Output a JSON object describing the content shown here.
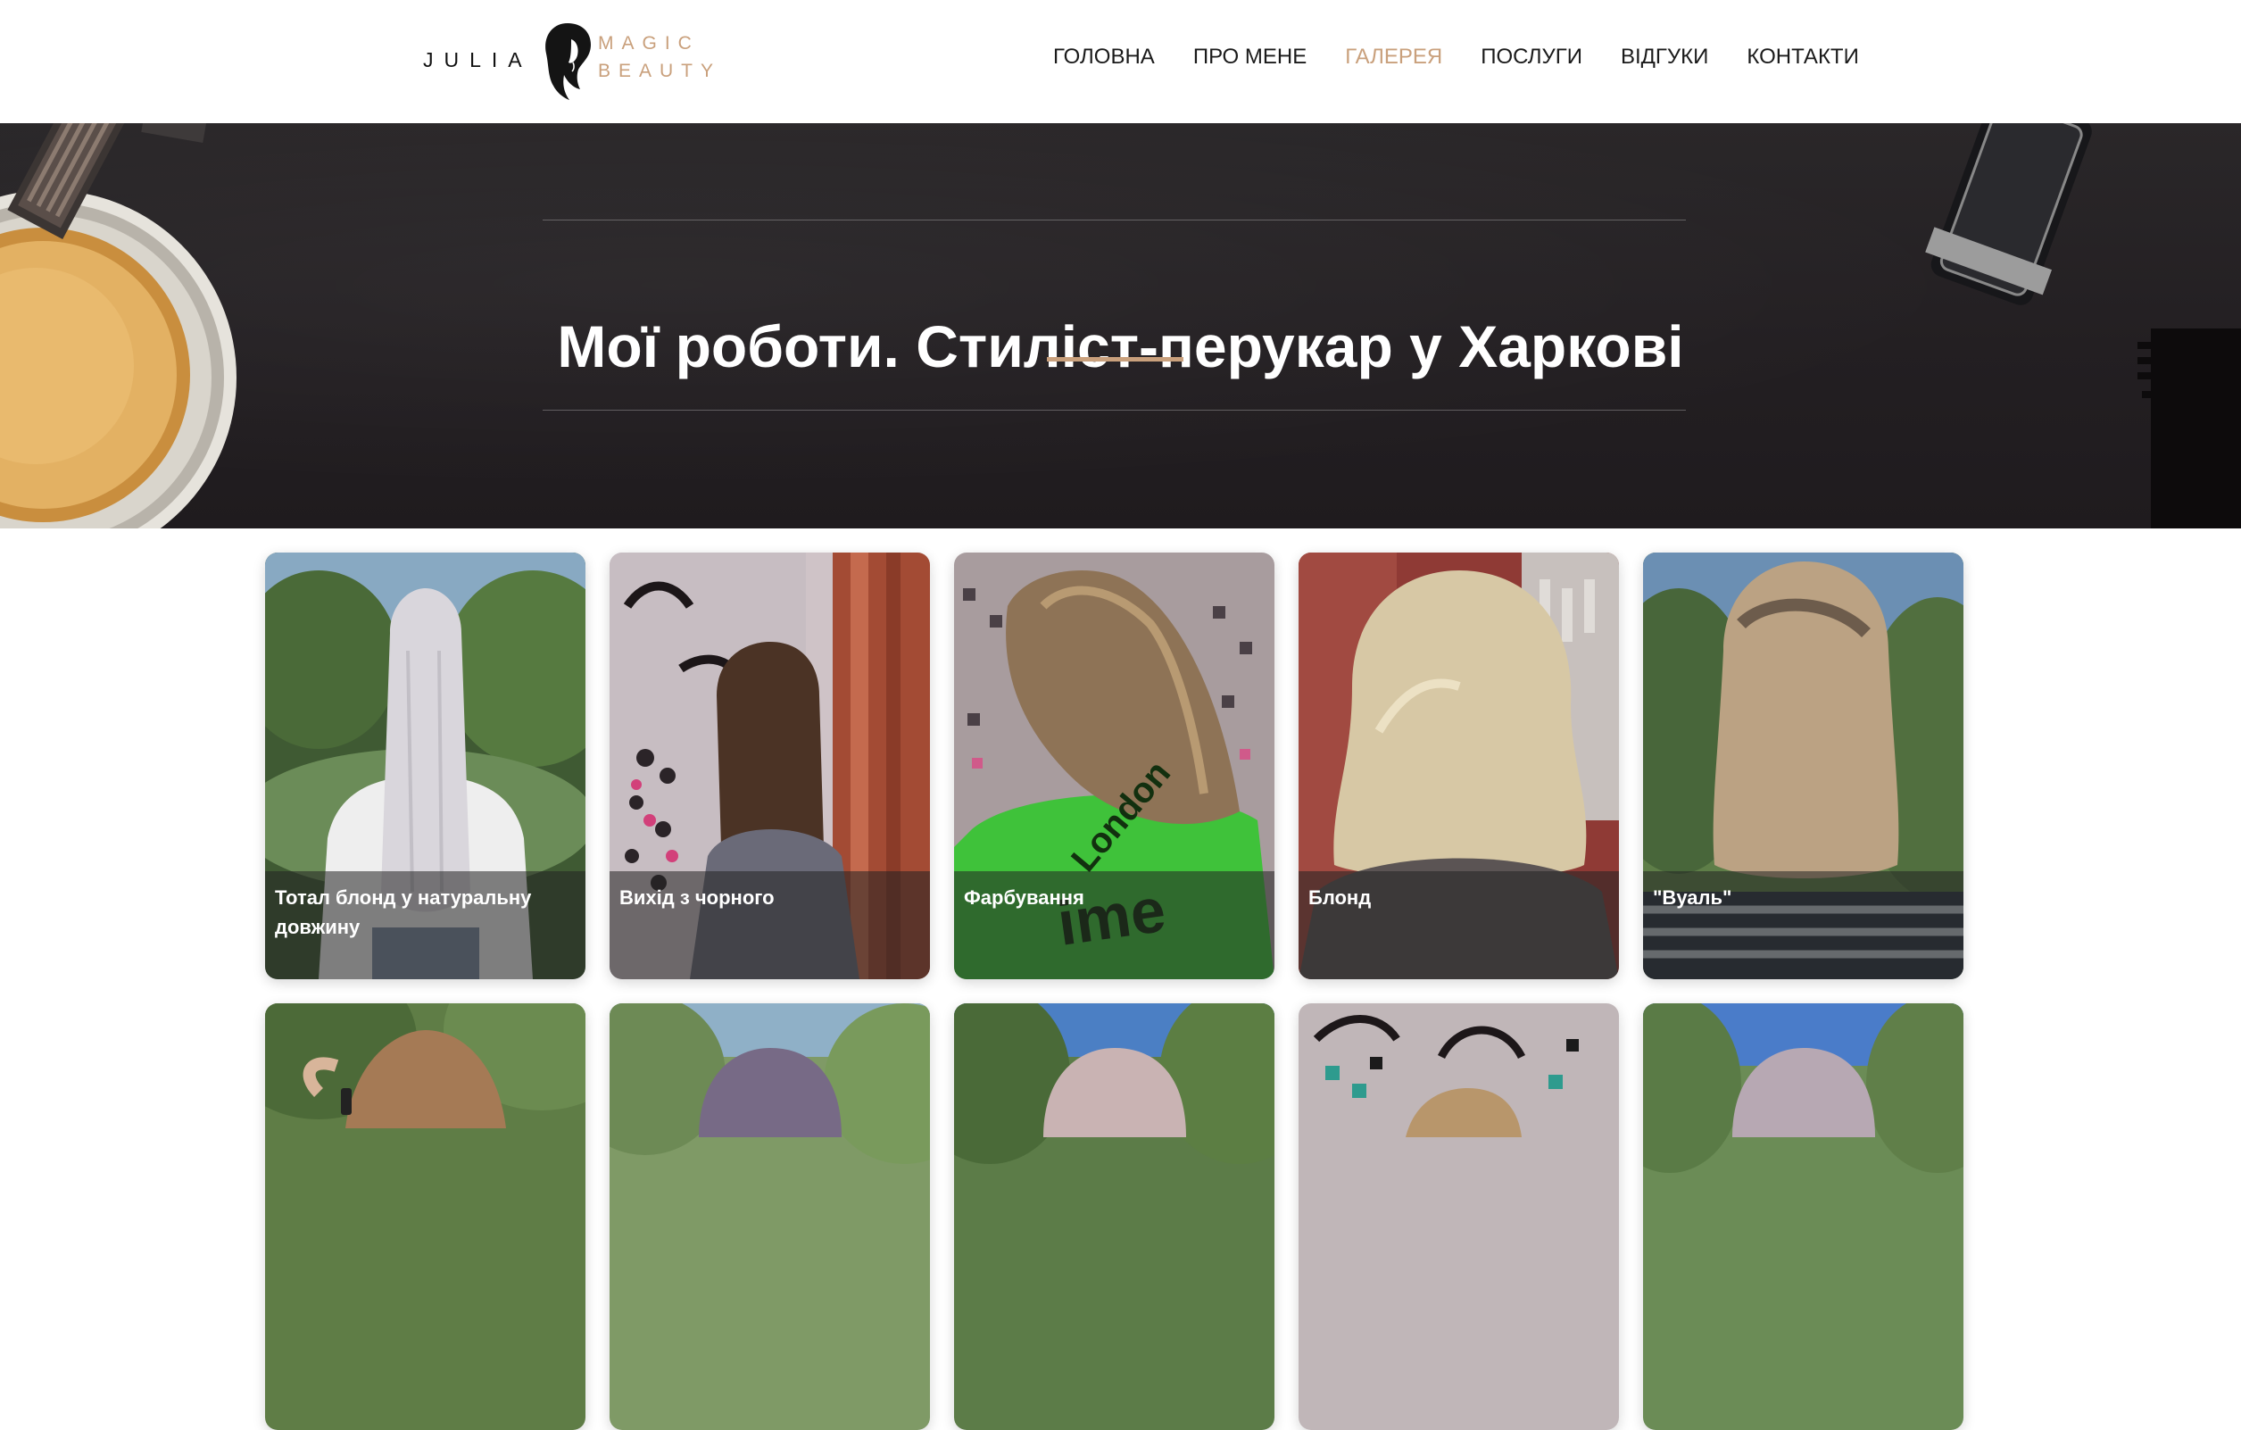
{
  "logo": {
    "left_text": "JULIA",
    "right_top": "MAGIC",
    "right_bottom": "BEAUTY"
  },
  "nav": {
    "items": [
      {
        "label": "ГОЛОВНА",
        "active": false
      },
      {
        "label": "ПРО МЕНЕ",
        "active": false
      },
      {
        "label": "ГАЛЕРЕЯ",
        "active": true
      },
      {
        "label": "ПОСЛУГИ",
        "active": false
      },
      {
        "label": "ВІДГУКИ",
        "active": false
      },
      {
        "label": "КОНТАКТИ",
        "active": false
      }
    ]
  },
  "hero": {
    "title": "Мої роботи. Стиліст-перукар у Харкові"
  },
  "gallery": {
    "row1": [
      {
        "caption": "Тотал блонд у натуральну довжину"
      },
      {
        "caption": "Вихід з чорного"
      },
      {
        "caption": "Фарбування"
      },
      {
        "caption": "Блонд"
      },
      {
        "caption": "\"Вуаль\""
      }
    ]
  },
  "colors": {
    "accent": "#c9a07c",
    "hero_bg": "#231f22",
    "text": "#1a1a1a"
  }
}
